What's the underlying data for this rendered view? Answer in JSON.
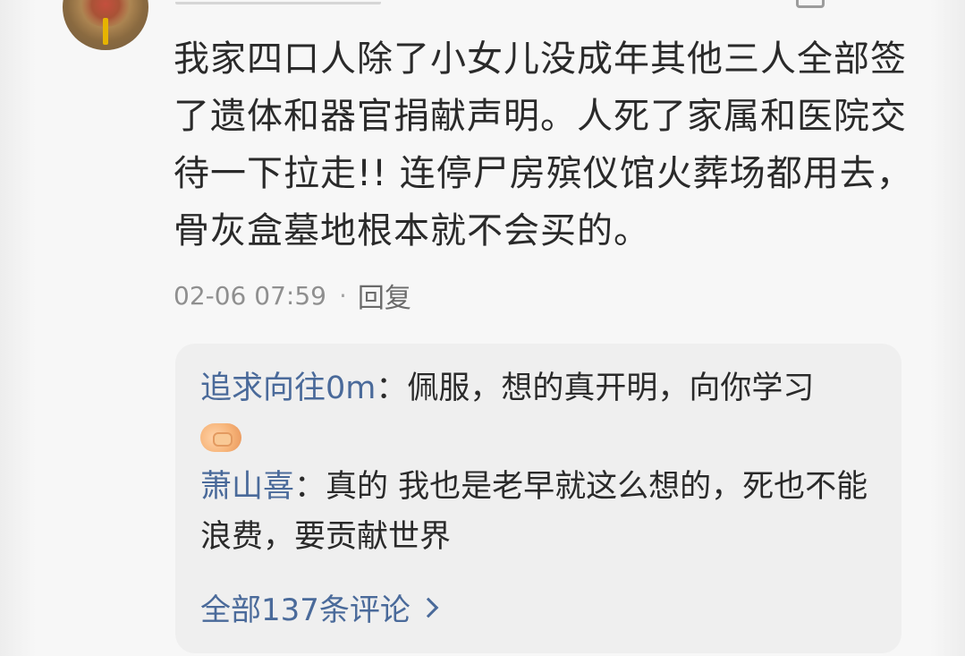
{
  "comment": {
    "text": "我家四口人除了小女儿没成年其他三人全部签了遗体和器官捐献声明。人死了家属和医院交待一下拉走!! 连停尸房殡仪馆火葬场都用去，骨灰盒墓地根本就不会买的。",
    "timestamp": "02-06 07:59",
    "separator": "·",
    "reply_label": "回复"
  },
  "replies": [
    {
      "author": "追求向往0m",
      "colon": "：",
      "text": "佩服，想的真开明，向你学习",
      "emoji": "handshake"
    },
    {
      "author": "萧山喜",
      "colon": "：",
      "text": "真的 我也是老早就这么想的，死也不能浪费，要贡献世界"
    }
  ],
  "all_comments_label": "全部137条评论",
  "colors": {
    "link": "#4a6a9a",
    "text": "#2a2a2a",
    "meta": "#8f8f8f",
    "reply_bg": "#efefef",
    "page_bg": "#f7f7f7"
  }
}
